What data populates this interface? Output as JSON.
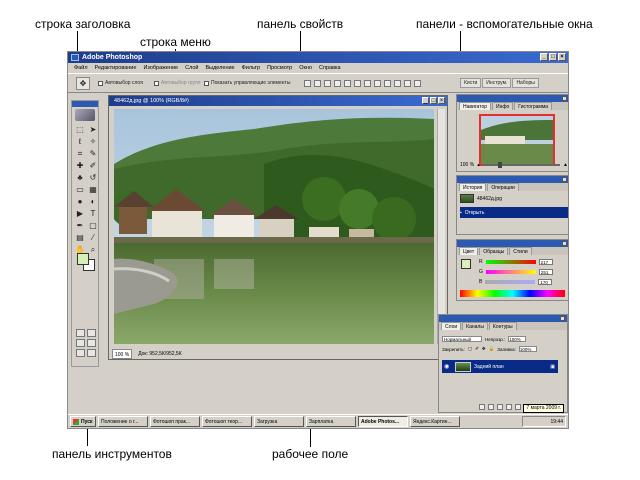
{
  "callouts": {
    "title_bar": "строка заголовка",
    "menu_bar": "строка меню",
    "options_bar": "панель свойств",
    "panels": "панели - вспомогательные окна",
    "toolbox": "панель инструментов",
    "workspace": "рабочее поле"
  },
  "window": {
    "title": "Adobe Photoshop",
    "buttons": [
      "_",
      "□",
      "×"
    ]
  },
  "menu": [
    "Файл",
    "Редактирование",
    "Изображение",
    "Слой",
    "Выделение",
    "Фильтр",
    "Просмотр",
    "Окно",
    "Справка"
  ],
  "options": {
    "auto_select_layer": "Автовыбор слоя",
    "auto_select_group": "Автовыбор групп",
    "show_controls": "Показать управляющие элементы",
    "tabs": [
      "Кисти",
      "Инструм.",
      "Наборы"
    ]
  },
  "document": {
    "title": "48462д.jpg @ 100% (RGB/8#)",
    "zoom": "100 %",
    "doc_size": "Док: 952,5К/952,5К"
  },
  "navigator": {
    "tabs": [
      "Навигатор",
      "Инфо",
      "Гистограмма"
    ],
    "zoom": "100 %"
  },
  "history": {
    "tabs": [
      "История",
      "Операции"
    ],
    "file": "48462д.jpg",
    "step": "Открыть"
  },
  "color": {
    "tabs": [
      "Цвет",
      "Образцы",
      "Стили"
    ],
    "channels": [
      {
        "label": "R",
        "value": "217",
        "gradient": "linear-gradient(to right,#00ff00,#ff0000)"
      },
      {
        "label": "G",
        "value": "251",
        "gradient": "linear-gradient(to right,#ff00ff,#ffff00)"
      },
      {
        "label": "B",
        "value": "170",
        "gradient": "linear-gradient(to right,#aaaaaa,#aaaaff)"
      }
    ],
    "fg_color": "#d7f0b8"
  },
  "layers": {
    "tabs": [
      "Слои",
      "Каналы",
      "Контуры"
    ],
    "blend_mode": "Нормальный",
    "opacity_label": "Непрозр.:",
    "opacity": "100%",
    "lock_label": "Закрепить:",
    "fill_label": "Заливка:",
    "fill": "100%",
    "layer_name": "Задний план"
  },
  "taskbar": {
    "start": "Пуск",
    "tasks": [
      "Положение о г...",
      "Фотошоп прак...",
      "Фотошоп теор...",
      "Загрузка",
      "Зарплатка",
      "Adobe Photos...",
      "Яндекс.Картин..."
    ],
    "active_index": 5,
    "time": "19:44",
    "tooltip": "7 марта 2009 г."
  }
}
